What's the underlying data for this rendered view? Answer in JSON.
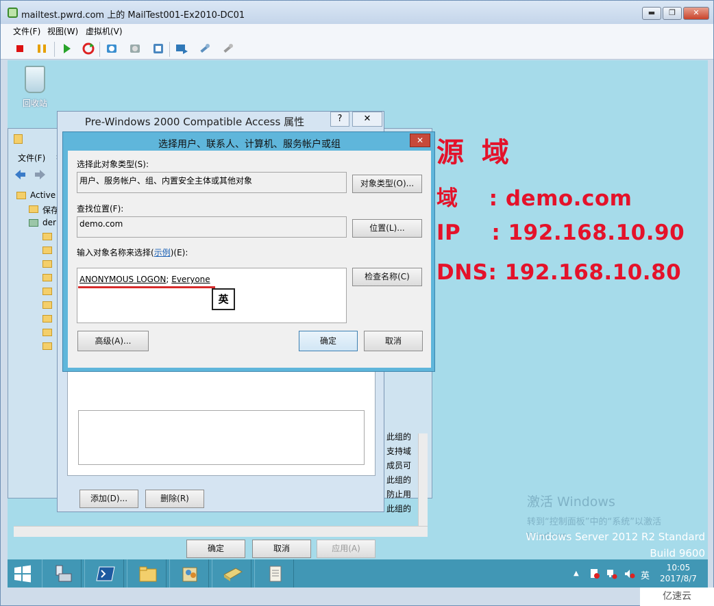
{
  "host": {
    "title": "mailtest.pwrd.com 上的 MailTest001-Ex2010-DC01",
    "menu": [
      "文件(F)",
      "视图(W)",
      "虚拟机(V)"
    ],
    "minimize_label": "▬",
    "maximize_label": "❐",
    "close_label": "✕"
  },
  "desktop": {
    "recycle_bin_label": "回收站",
    "wallpaper_lines": [
      "源 域",
      "域    : demo.com",
      "IP    : 192.168.10.90",
      "DNS: 192.168.10.80"
    ],
    "activation": {
      "line1": "激活 Windows",
      "line2": "转到“控制面板”中的“系统”以激活",
      "line3": "Windows。"
    },
    "build_info": {
      "line1": "Windows Server 2012 R2 Standard",
      "line2": "Build 9600"
    },
    "wallpaper_color": "#e4122a"
  },
  "taskbar": {
    "apps": [
      "server-manager",
      "powershell",
      "file-explorer",
      "active-directory-users",
      "exchange-console",
      "notepad"
    ],
    "ime_indicator": "英",
    "clock_time": "10:05",
    "clock_date": "2017/8/7"
  },
  "aduc": {
    "menu_file": "文件(F)",
    "menu_partial": "操",
    "tree": [
      "Active",
      "保存",
      "der"
    ],
    "right_col": [
      "此组的",
      "支持域",
      "成员可",
      "此组的",
      "防止用",
      "此组的"
    ]
  },
  "props": {
    "title": "Pre-Windows 2000 Compatible Access 属性",
    "help_label": "?",
    "close_label": "✕",
    "add_button": "添加(D)...",
    "remove_button": "删除(R)",
    "ok_button": "确定",
    "cancel_button": "取消",
    "apply_button": "应用(A)"
  },
  "select_dialog": {
    "title": "选择用户、联系人、计算机、服务帐户或组",
    "close_label": "✕",
    "object_type_label": "选择此对象类型(S):",
    "object_type_value": "用户、服务帐户、组、内置安全主体或其他对象",
    "object_type_button": "对象类型(O)...",
    "location_label": "查找位置(F):",
    "location_value": "demo.com",
    "location_button": "位置(L)...",
    "names_label_prefix": "输入对象名称来选择(",
    "names_label_link": "示例",
    "names_label_suffix": ")(E):",
    "name1": "ANONYMOUS LOGON",
    "name_sep": "; ",
    "name2": "Everyone",
    "ime_popup": "英",
    "check_names_button": "检查名称(C)",
    "advanced_button": "高级(A)...",
    "ok_button": "确定",
    "cancel_button": "取消"
  },
  "watermark": "亿速云"
}
